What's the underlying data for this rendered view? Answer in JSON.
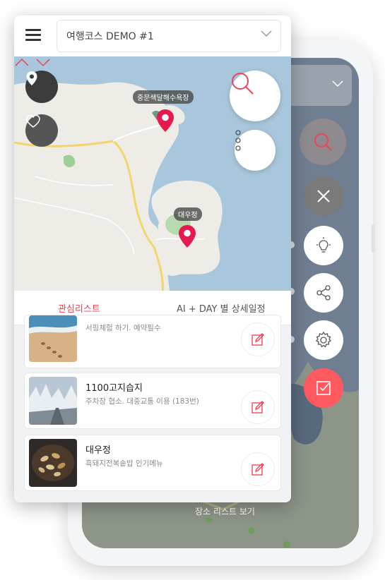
{
  "header": {
    "course_select": "여행코스 DEMO #1"
  },
  "map": {
    "places": [
      {
        "name": "중문색달해수욕장"
      },
      {
        "name": "대우정"
      }
    ]
  },
  "tabs": [
    {
      "label": "관심리스트",
      "active": true,
      "color": "#ef3b4c"
    },
    {
      "label": "AI + DAY 별 상세일정",
      "active": false
    }
  ],
  "list": {
    "items": [
      {
        "title": "",
        "subtitle": "서핑체험 하기. 예약필수",
        "thumb": "beach-footprints"
      },
      {
        "title": "1100고지습지",
        "subtitle": "주차장 협소. 대중교통 이용 (183번)",
        "thumb": "snowy-forest"
      },
      {
        "title": "대우정",
        "subtitle": "흑돼지전복솥밥 인기메뉴",
        "thumb": "abalone-dish"
      }
    ]
  },
  "back_phone": {
    "list_view": "장소 리스트 보기",
    "fab_icons": [
      "search-icon",
      "close-icon",
      "bulb-icon",
      "share-icon",
      "gear-icon",
      "checkbox-icon"
    ]
  },
  "colors": {
    "accent": "#ef3b4c",
    "pin": "#e8194f",
    "sea": "#a9c7dc",
    "land": "#eeece6",
    "road": "#f2d56b",
    "fab_check": "#ff5a5f"
  }
}
